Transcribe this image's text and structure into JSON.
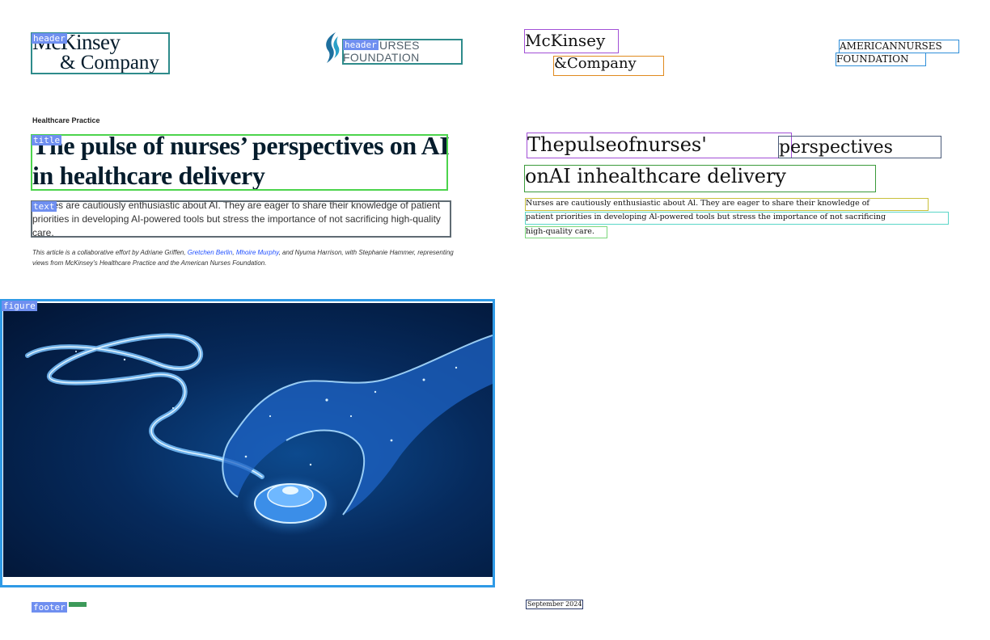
{
  "annotation_labels": {
    "header": "header",
    "title": "title",
    "text": "text",
    "figure": "figure",
    "footer": "footer"
  },
  "page": {
    "logo_mckinsey": {
      "line1": "McKinsey",
      "line2": "& Company"
    },
    "logo_anf": {
      "line1": "AMERICAN NURSES",
      "line2": "FOUNDATION",
      "visible_line1": "CAN NURSES"
    },
    "kicker": "Healthcare Practice",
    "title": "The pulse of nurses’ perspectives on AI in healthcare delivery",
    "lead": "Nurses are cautiously enthusiastic about AI. They are eager to share their knowledge of patient priorities in developing AI-powered tools but stress the importance of not sacrificing high-quality care.",
    "byline": {
      "prefix": "This article is a collaborative effort by Adriane Griffen, ",
      "author2": "Gretchen Berlin",
      "sep": ", ",
      "author3": "Mhoire Murphy",
      "suffix": ", and Nyuma Harrison, with Stephanie Hammer, representing views from McKinsey’s Healthcare Practice and the American Nurses Foundation."
    }
  },
  "ocr": {
    "mck_line1": "McKinsey",
    "mck_line2": "&Company",
    "anf_line1": "AMERICANNURSES",
    "anf_line2": "FOUNDATION",
    "title_a": "Thepulseofnurses'",
    "title_b": "perspectives",
    "title_c": "onAI inhealthcare delivery",
    "lead_1": "Nurses are cautiously enthusiastic about Al. They are eager to share their knowledge of",
    "lead_2": "patient priorities in developing Al-powered tools but stress the importance of not sacrificing",
    "lead_3": "high-quality care.",
    "date": "September 2024"
  },
  "colors": {
    "header_box": "#2e8b8b",
    "title_box": "#4cd44c",
    "text_box": "#5f6b73",
    "figure_box": "#2f9ae6",
    "tag_bg": "#6f8ff0"
  }
}
